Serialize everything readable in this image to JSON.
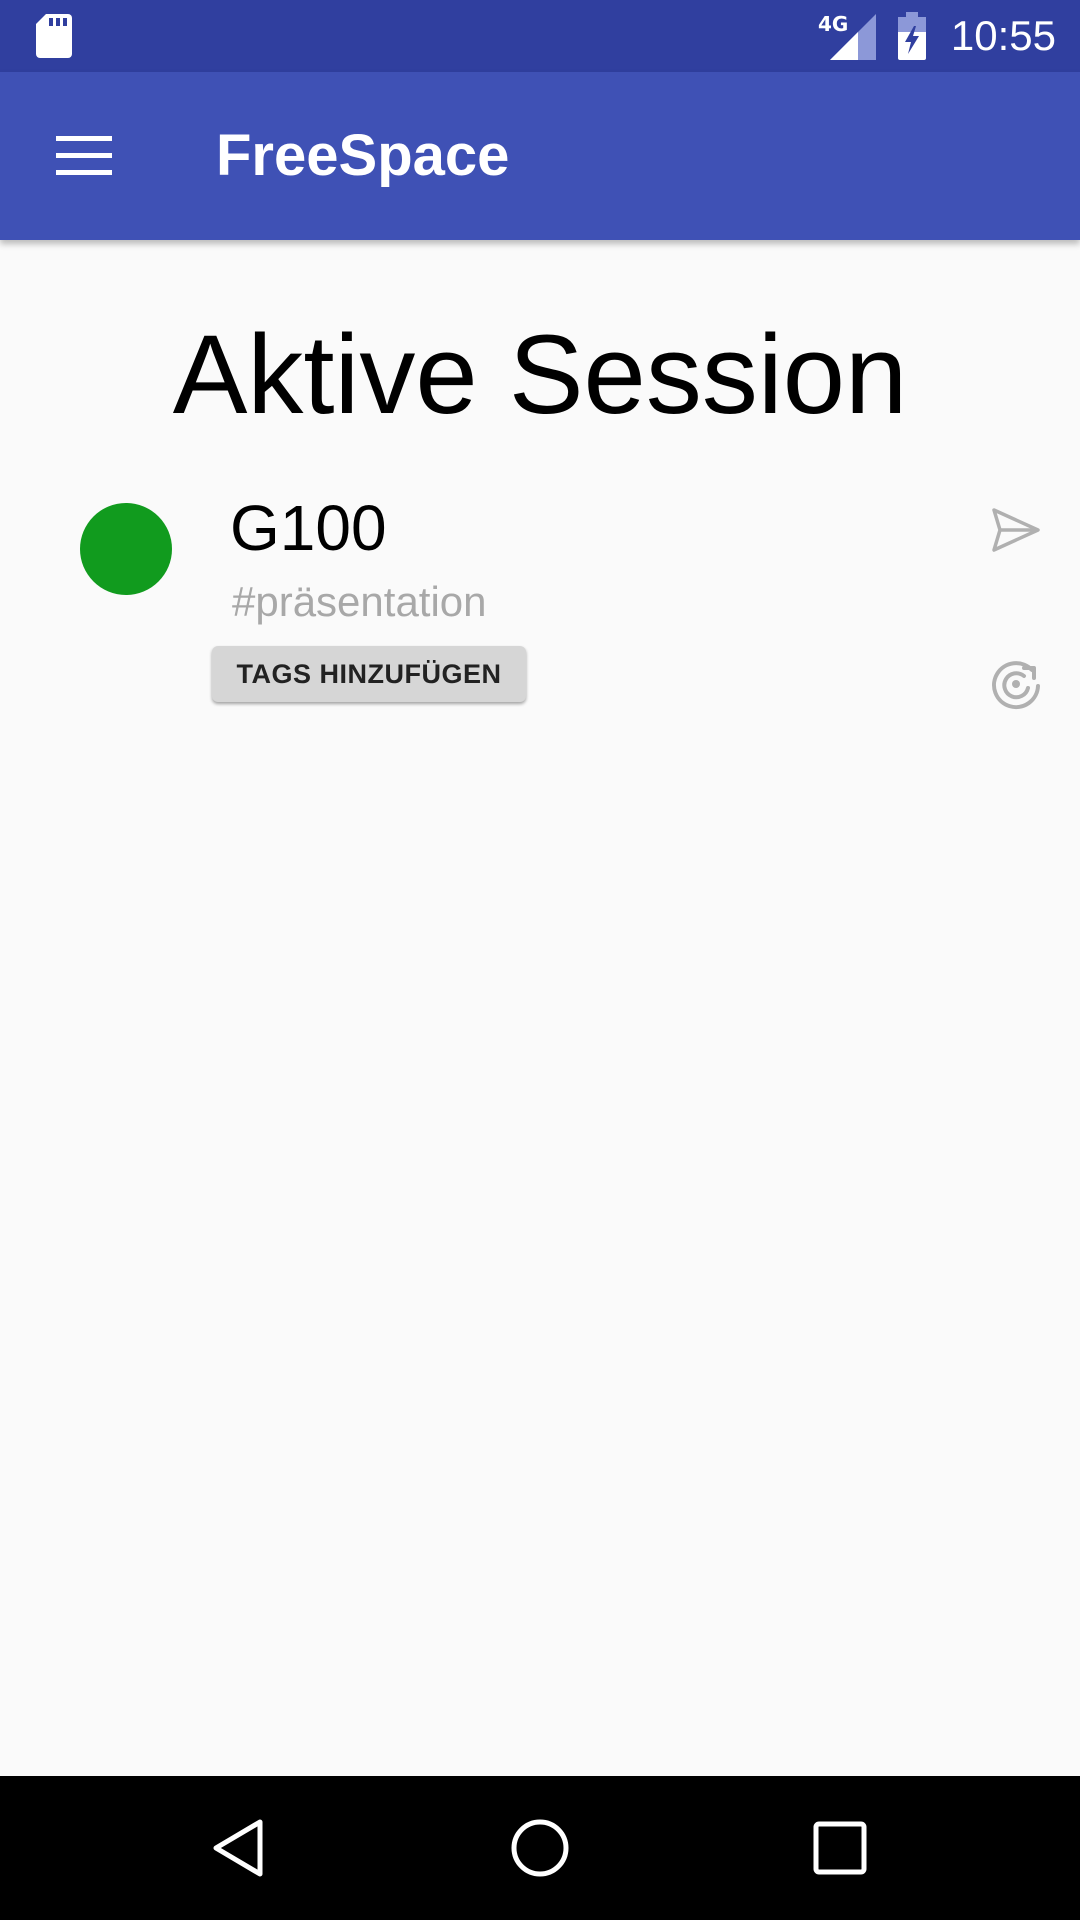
{
  "status_bar": {
    "network_type": "4G",
    "time": "10:55",
    "icons": [
      "sd-card-icon",
      "signal-icon",
      "battery-charging-icon"
    ]
  },
  "app_bar": {
    "title": "FreeSpace",
    "menu_icon": "hamburger-menu-icon"
  },
  "main": {
    "title": "Aktive Session",
    "session": {
      "status_color": "#119b1e",
      "room": "G100",
      "tag": "#präsentation",
      "add_tags_label": "TAGS HINZUFÜGEN",
      "actions": [
        "send-icon",
        "refresh-icon"
      ]
    }
  },
  "nav_bar": {
    "buttons": [
      "back-icon",
      "home-icon",
      "recents-icon"
    ]
  },
  "colors": {
    "status_bar": "#303f9f",
    "app_bar": "#3f51b5",
    "background": "#fafafa"
  }
}
